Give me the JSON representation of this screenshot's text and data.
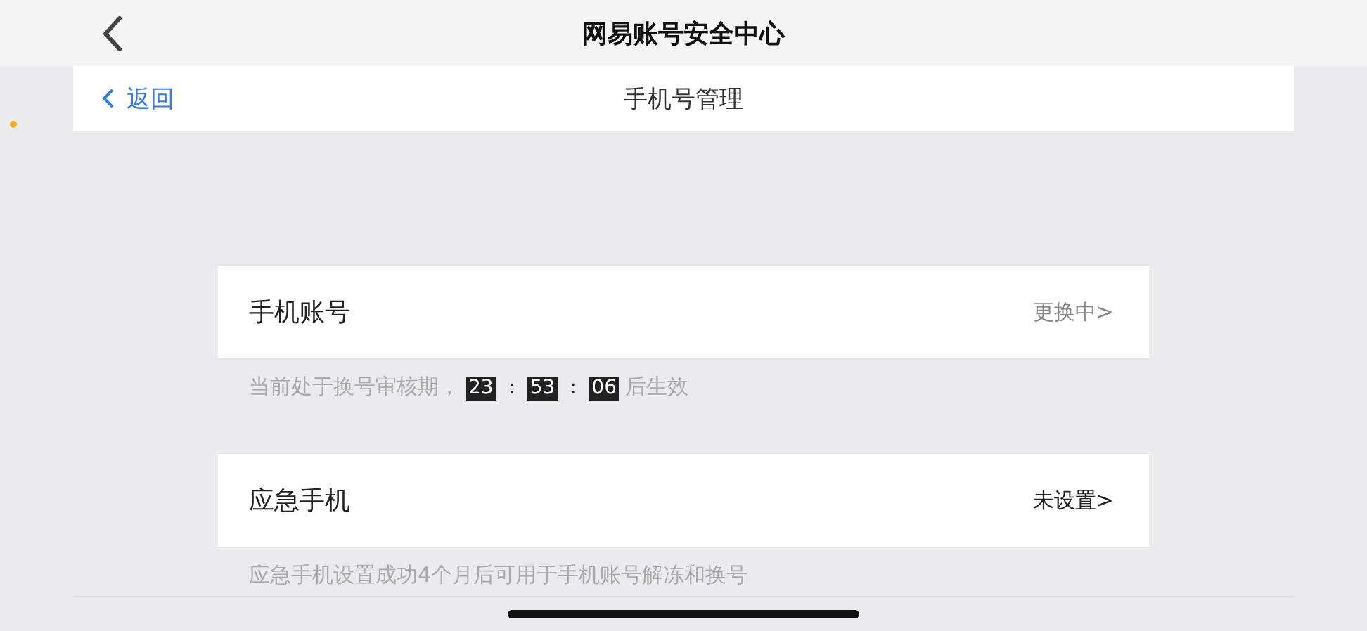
{
  "nav_bar": {
    "title": "网易账号安全中心"
  },
  "sub_header": {
    "back_link": "返回",
    "title": "手机号管理"
  },
  "sections": [
    {
      "label": "手机账号",
      "status": "更换中>",
      "kind": "pending",
      "note": {
        "prefix": "当前处于换号审核期，",
        "countdown": [
          "23",
          "53",
          "06"
        ],
        "separators": [
          "：",
          "："
        ],
        "suffix": "后生效"
      }
    },
    {
      "label": "应急手机",
      "status": "未设置>",
      "kind": "unset",
      "note": {
        "prefix": "应急手机设置成功4个月后可用于手机账号解冻和换号"
      }
    }
  ]
}
